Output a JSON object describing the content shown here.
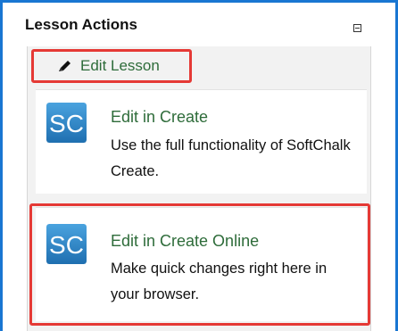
{
  "panel": {
    "title": "Lesson Actions",
    "collapse_icon": "minus-box-icon"
  },
  "edit_lesson": {
    "label": "Edit Lesson",
    "icon": "pencil-icon"
  },
  "options": [
    {
      "title": "Edit in Create",
      "description": "Use the full functionality of SoftChalk Create.",
      "logo_text": "SC"
    },
    {
      "title": "Edit in Create Online",
      "description": "Make quick changes right here in your browser.",
      "logo_text": "SC"
    }
  ],
  "colors": {
    "accent_border": "#1976d2",
    "highlight": "#e53935",
    "link_green": "#2e6c3a",
    "logo_blue": "#2a84c8"
  }
}
